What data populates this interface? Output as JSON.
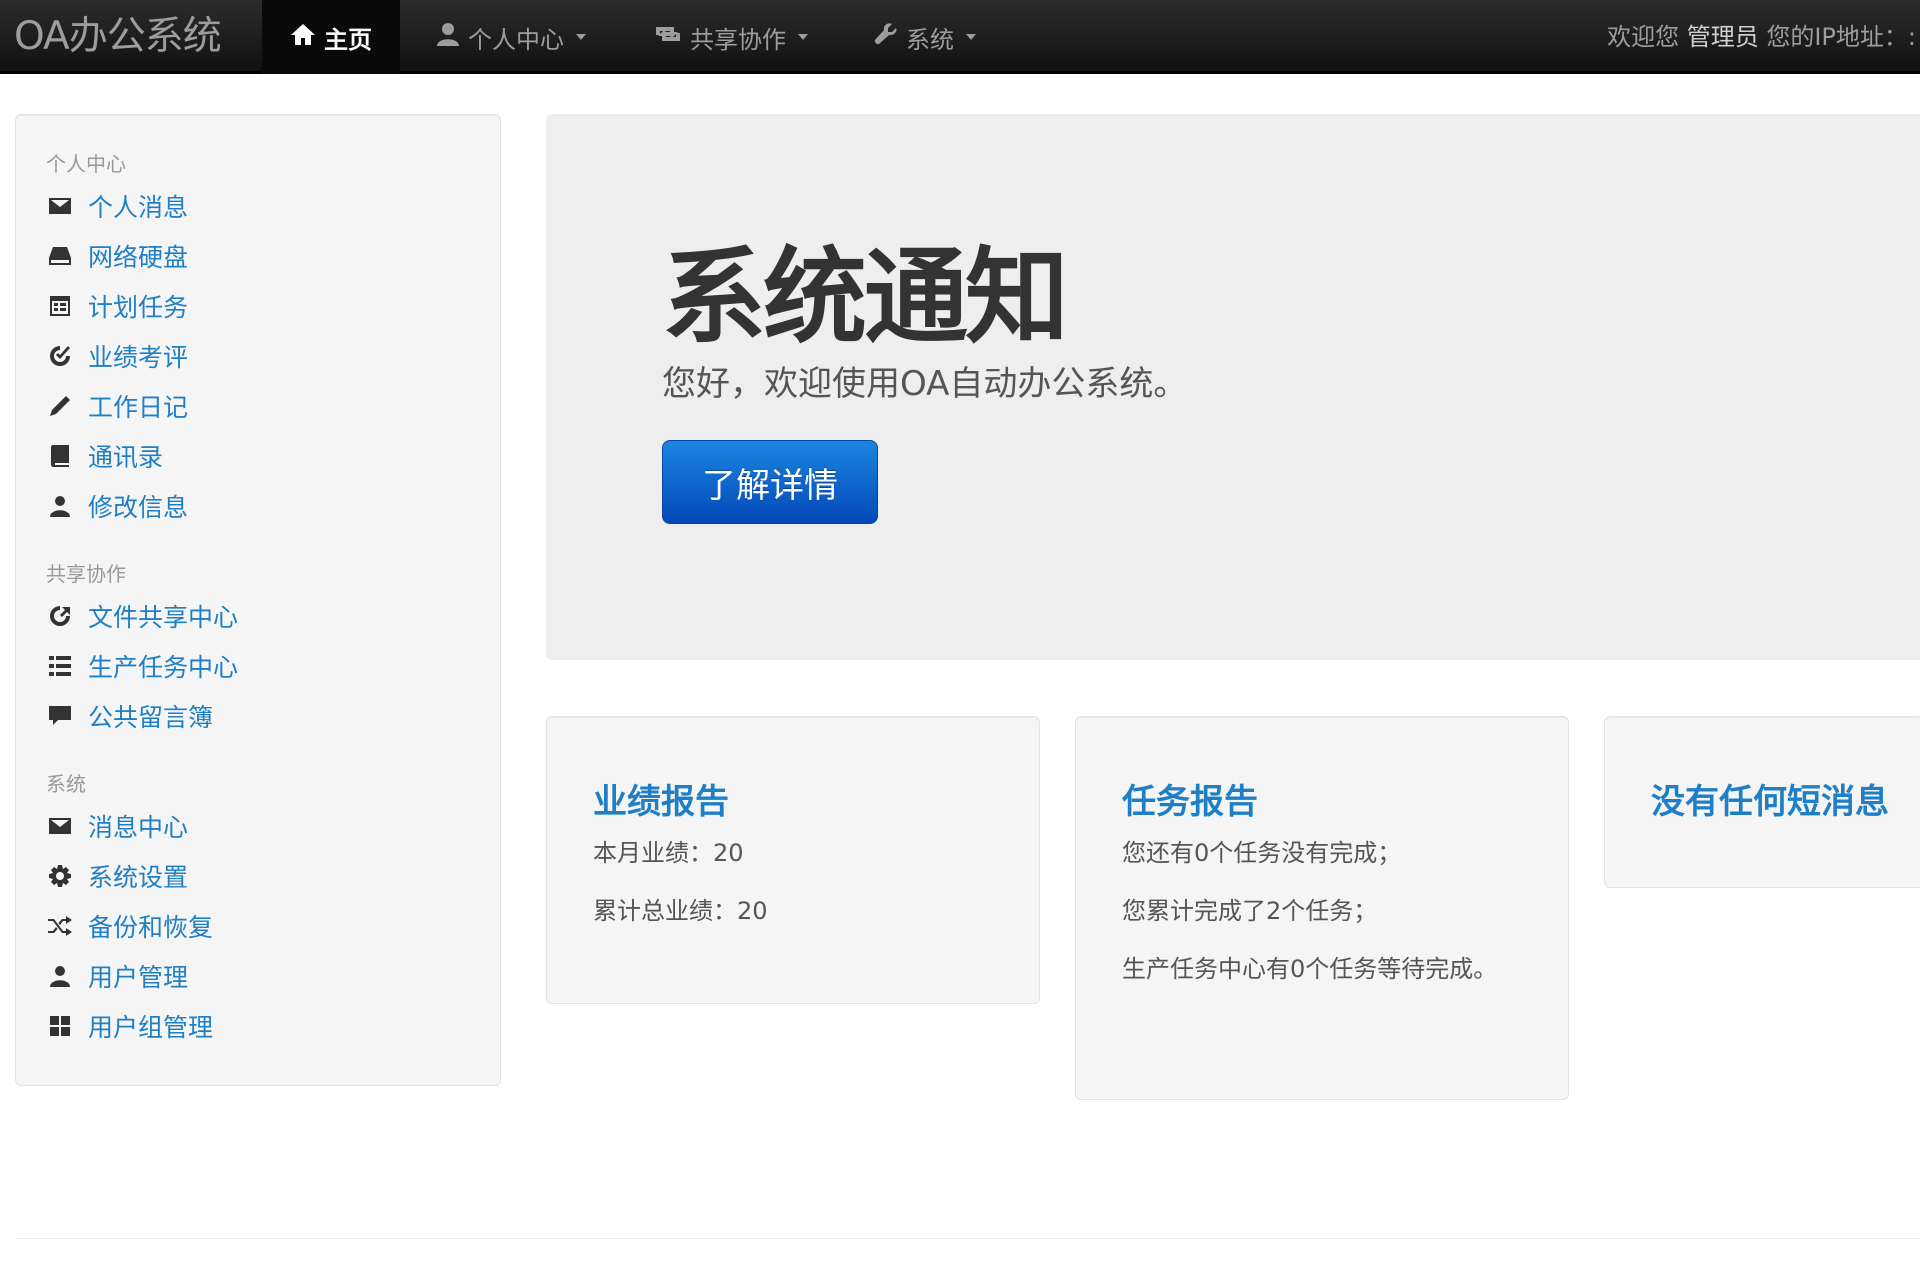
{
  "navbar": {
    "brand": "OA办公系统",
    "items": [
      {
        "label": "主页",
        "icon": "home-icon",
        "active": true
      },
      {
        "label": "个人中心",
        "icon": "user-icon",
        "dropdown": true
      },
      {
        "label": "共享协作",
        "icon": "retweet-icon",
        "dropdown": true
      },
      {
        "label": "系统",
        "icon": "wrench-icon",
        "dropdown": true
      }
    ],
    "welcome_prefix": "欢迎您",
    "username": "管理员",
    "ip_label": "您的IP地址：:"
  },
  "sidebar": {
    "sections": [
      {
        "header": "个人中心",
        "items": [
          {
            "label": "个人消息",
            "icon": "envelope-icon"
          },
          {
            "label": "网络硬盘",
            "icon": "hdd-icon"
          },
          {
            "label": "计划任务",
            "icon": "calendar-icon"
          },
          {
            "label": "业绩考评",
            "icon": "check-icon"
          },
          {
            "label": "工作日记",
            "icon": "pencil-icon"
          },
          {
            "label": "通讯录",
            "icon": "book-icon"
          },
          {
            "label": "修改信息",
            "icon": "user-icon"
          }
        ]
      },
      {
        "header": "共享协作",
        "items": [
          {
            "label": "文件共享中心",
            "icon": "share-icon"
          },
          {
            "label": "生产任务中心",
            "icon": "list-icon"
          },
          {
            "label": "公共留言簿",
            "icon": "comment-icon"
          }
        ]
      },
      {
        "header": "系统",
        "items": [
          {
            "label": "消息中心",
            "icon": "envelope-icon"
          },
          {
            "label": "系统设置",
            "icon": "cog-icon"
          },
          {
            "label": "备份和恢复",
            "icon": "random-icon"
          },
          {
            "label": "用户管理",
            "icon": "user-icon"
          },
          {
            "label": "用户组管理",
            "icon": "th-large-icon"
          }
        ]
      }
    ]
  },
  "hero": {
    "title": "系统通知",
    "subtitle": "您好，欢迎使用OA自动办公系统。",
    "button_label": "了解详情"
  },
  "cards": {
    "performance": {
      "title": "业绩报告",
      "lines": [
        "本月业绩：20",
        "累计总业绩：20"
      ]
    },
    "tasks": {
      "title": "任务报告",
      "lines": [
        "您还有0个任务没有完成；",
        "您累计完成了2个任务；",
        "生产任务中心有0个任务等待完成。"
      ]
    },
    "messages": {
      "title": "没有任何短消息"
    }
  },
  "colors": {
    "navbar_bg": "#1b1b1b",
    "link": "#1f7fc6",
    "primary_button": "#0a6cd6",
    "panel_bg": "#f5f5f5",
    "hero_bg": "#eeeeee"
  }
}
